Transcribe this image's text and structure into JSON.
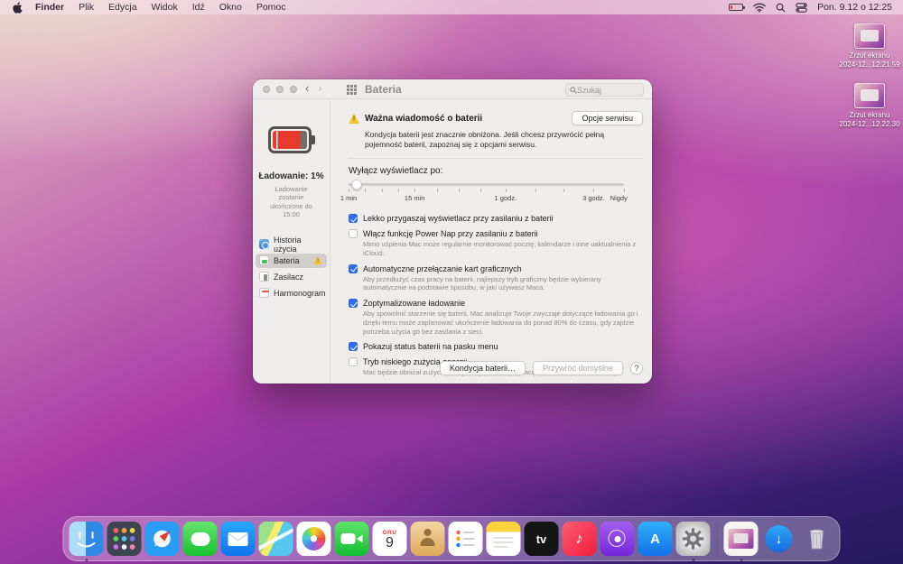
{
  "menu_bar": {
    "items": [
      "Finder",
      "Plik",
      "Edycja",
      "Widok",
      "Idź",
      "Okno",
      "Pomoc"
    ],
    "clock": "Pon. 9.12 o 12:25"
  },
  "icons": {
    "back": "‹",
    "forward": "›"
  },
  "desktop": {
    "files": [
      {
        "line1": "Zrzut ekranu",
        "line2": "2024-12...12.21.59"
      },
      {
        "line1": "Zrzut ekranu",
        "line2": "2024-12...12.22.30"
      }
    ]
  },
  "window": {
    "title": "Bateria",
    "search_placeholder": "Szukaj",
    "sidebar": {
      "charging_label": "Ładowanie: 1%",
      "charging_sub": "Ładowanie zostanie ukończone do 15:00",
      "items": [
        {
          "label": "Historia użycia",
          "selected": false
        },
        {
          "label": "Bateria",
          "selected": true,
          "warning": true
        },
        {
          "label": "Zasilacz",
          "selected": false
        },
        {
          "label": "Harmonogram",
          "selected": false
        }
      ]
    },
    "warning": {
      "title": "Ważna wiadomość o baterii",
      "button": "Opcje serwisu",
      "body": "Kondycja baterii jest znacznie obniżona. Jeśli chcesz przywrócić pełną pojemność baterii, zapoznaj się z opcjami serwisu."
    },
    "display_sleep": {
      "label": "Wyłącz wyświetlacz po:",
      "value_pct": 3,
      "ticks": [
        {
          "label": "1 min",
          "pct": 0
        },
        {
          "label": "15 min",
          "pct": 24
        },
        {
          "label": "1 godz.",
          "pct": 57
        },
        {
          "label": "3 godz.",
          "pct": 89
        },
        {
          "label": "Nigdy",
          "pct": 100
        }
      ]
    },
    "checkboxes": [
      {
        "label": "Lekko przygaszaj wyświetlacz przy zasilaniu z baterii",
        "checked": true
      },
      {
        "label": "Włącz funkcję Power Nap przy zasilaniu z baterii",
        "checked": false,
        "sub": "Mimo uśpienia Mac może regularnie monitorować pocztę, kalendarze i inne uaktualnienia z iCloud."
      },
      {
        "label": "Automatyczne przełączanie kart graficznych",
        "checked": true,
        "sub": "Aby przedłużyć czas pracy na baterii, najlepszy tryb graficzny będzie wybierany automatycznie na podstawie sposobu, w jaki używasz Maca."
      },
      {
        "label": "Zoptymalizowane ładowanie",
        "checked": true,
        "sub": "Aby spowolnić starzenie się baterii, Mac analizuje Twoje zwyczaje dotyczące ładowania go i dzięki temu może zaplanować ukończenie ładowania do ponad 80% do czasu, gdy zajdzie potrzeba użycia go bez zasilania z sieci."
      },
      {
        "label": "Pokazuj status baterii na pasku menu",
        "checked": true
      },
      {
        "label": "Tryb niskiego zużycia energii",
        "checked": false,
        "sub": "Mac będzie obniżał zużycie energii, aby przedłużyć pracę na baterii i pracował ciszej."
      }
    ],
    "footer": {
      "battery_health": "Kondycja baterii…",
      "restore_defaults": "Przywróć domyślne",
      "help": "?"
    }
  },
  "dock": {
    "items": [
      "finder",
      "launchpad",
      "safari",
      "messages",
      "mail",
      "maps",
      "photos",
      "facetime",
      "calendar",
      "contacts",
      "reminders",
      "notes",
      "tv",
      "music",
      "podcasts",
      "app-store",
      "system-preferences",
      "screenshot-file",
      "downloads",
      "trash"
    ],
    "calendar_month": "GRU",
    "calendar_day": "9",
    "tv_label": "tv",
    "app_store_label": "A",
    "music_glyph": "♪",
    "downloads_glyph": "↓"
  }
}
